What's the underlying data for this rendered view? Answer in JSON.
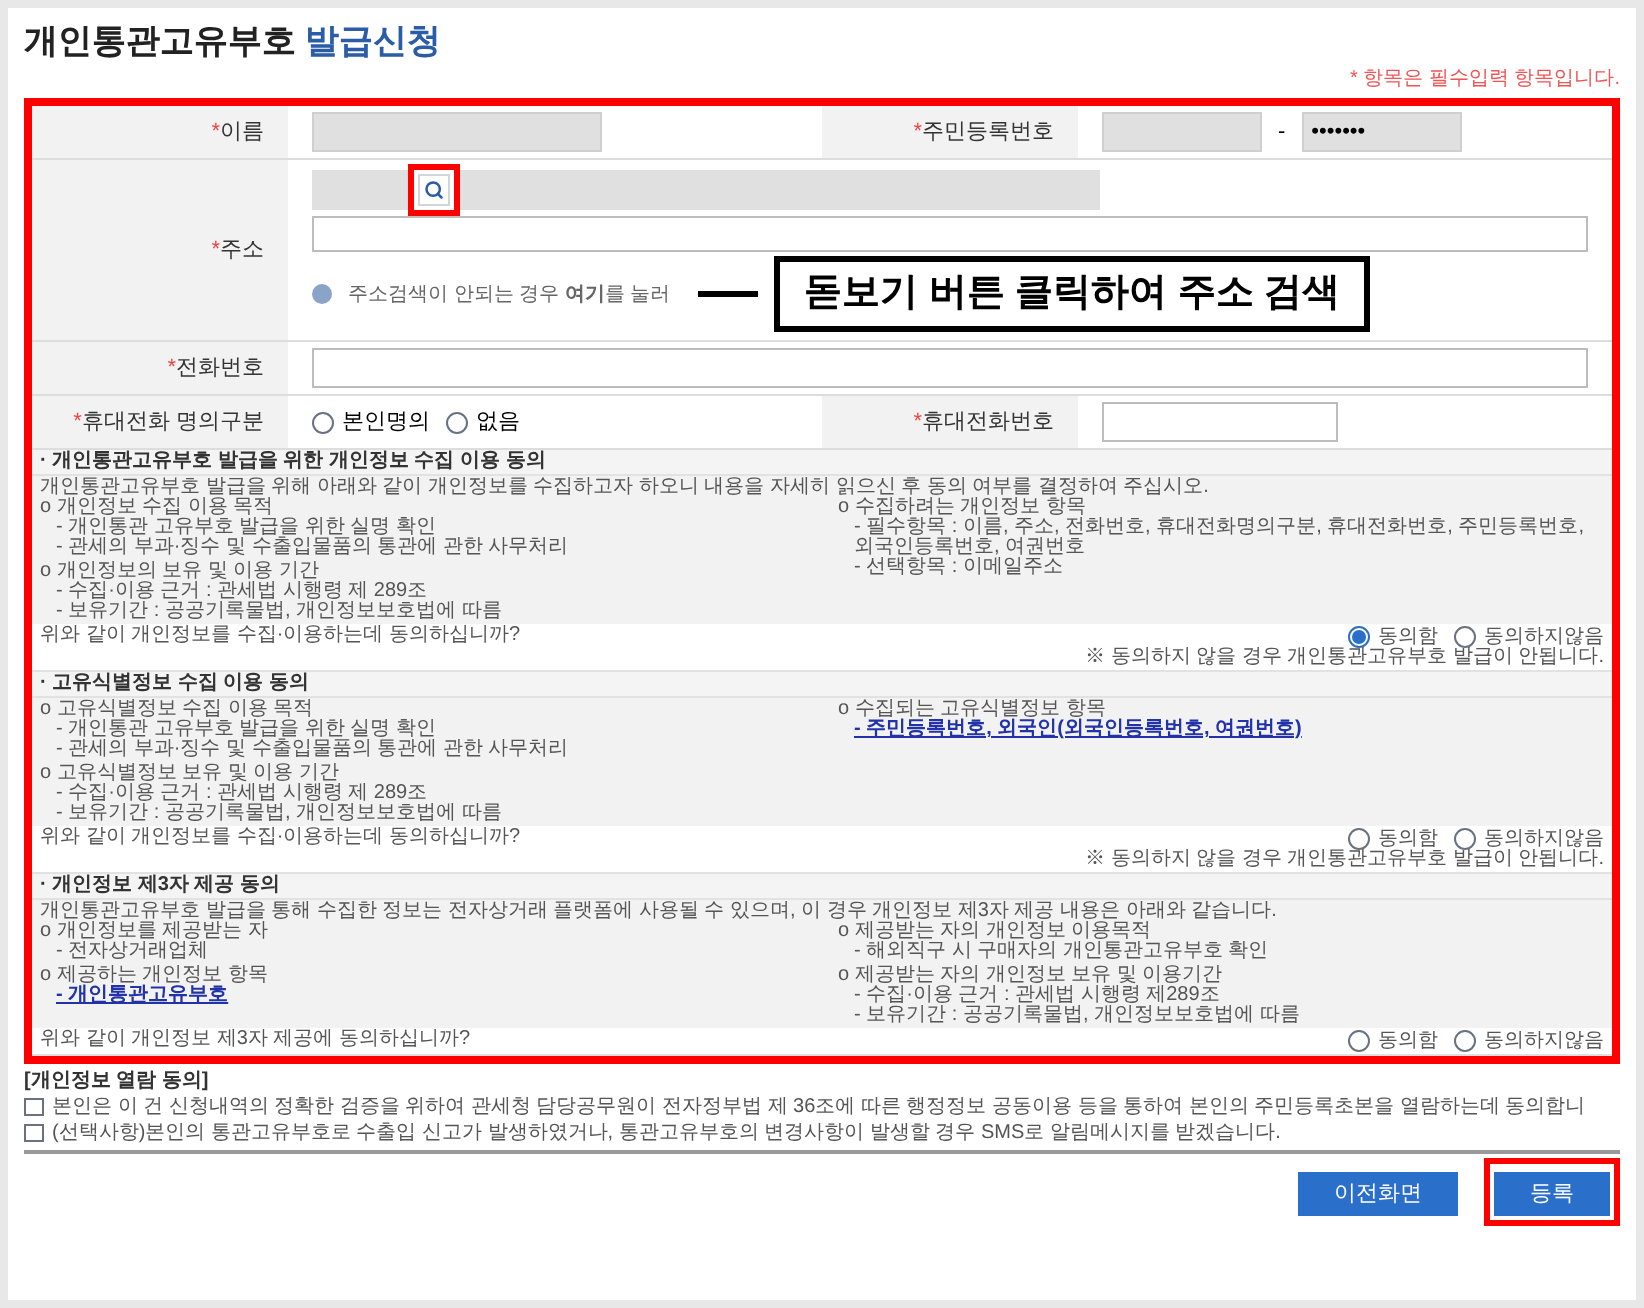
{
  "title": {
    "main": "개인통관고유부호",
    "accent": "발급신청"
  },
  "required_note": "* 항목은 필수입력 항목입니다.",
  "form_rows": [
    {
      "cells": [
        {
          "label": "이름",
          "required_mark": "*",
          "kind": "text",
          "disabled": true
        },
        {
          "label": "주민등록번호",
          "required_mark": "*",
          "kind": "rrn",
          "disabled": true,
          "separator": "-",
          "masked_value": "•••••••"
        }
      ]
    },
    {
      "cells": [
        {
          "label": "주소",
          "required_mark": "*",
          "kind": "address",
          "disabled": true,
          "hint": "주소검색이 안되는 경우 **여기**를 눌러"
        }
      ]
    },
    {
      "cells": [
        {
          "label": "전화번호",
          "required_mark": "*",
          "kind": "text",
          "disabled": false
        }
      ]
    },
    {
      "cells": [
        {
          "label": "휴대전화 명의구분",
          "required_mark": "*",
          "kind": "radio",
          "options": [
            {
              "label": "본인명의",
              "selected": false
            },
            {
              "label": "없음",
              "selected": false
            }
          ]
        },
        {
          "label": "휴대전화번호",
          "required_mark": "*",
          "kind": "short",
          "disabled": false
        }
      ]
    }
  ],
  "callout": "돋보기 버튼 클릭하여 주소 검색",
  "consents": [
    {
      "title": "· 개인통관고유부호 발급을 위한 개인정보 수집 이용 동의",
      "intro": "개인통관고유부호 발급을 위해 아래와 같이 개인정보를 수집하고자 하오니 내용을 자세히 읽으신 후 동의 여부를 결정하여 주십시오.",
      "groups": [
        {
          "heading": "o 개인정보 수집 이용 목적",
          "link_items": false,
          "items": [
            "- 개인통관 고유부호 발급을 위한 실명 확인",
            "- 관세의 부과·징수 및 수출입물품의 통관에 관한 사무처리"
          ]
        },
        {
          "heading": "o 수집하려는 개인정보 항목",
          "link_items": false,
          "items": [
            "- 필수항목 : 이름, 주소, 전화번호, 휴대전화명의구분, 휴대전화번호, 주민등록번호, 외국인등록번호, 여권번호",
            "- 선택항목 : 이메일주소"
          ]
        },
        {
          "heading": "o 개인정보의 보유 및 이용 기간",
          "link_items": false,
          "items": [
            "- 수집·이용 근거 : 관세법 시행령 제 289조",
            "- 보유기간 : 공공기록물법, 개인정보보호법에 따름"
          ]
        }
      ],
      "question": "위와 같이 개인정보를 수집·이용하는데 동의하십니까?",
      "options": [
        {
          "label": "동의함",
          "selected": true
        },
        {
          "label": "동의하지않음",
          "selected": false
        }
      ],
      "note": "※ 동의하지 않을 경우 개인통관고유부호 발급이 안됩니다."
    },
    {
      "title": "· 고유식별정보 수집 이용 동의",
      "groups": [
        {
          "heading": "o 고유식별정보 수집 이용 목적",
          "link_items": false,
          "items": [
            "- 개인통관 고유부호 발급을 위한 실명 확인",
            "- 관세의 부과·징수 및 수출입물품의 통관에 관한 사무처리"
          ]
        },
        {
          "heading": "o 수집되는 고유식별정보 항목",
          "link_items": true,
          "items": [
            "- 주민등록번호, 외국인(외국인등록번호, 여권번호)"
          ]
        },
        {
          "heading": "o 고유식별정보 보유 및 이용 기간",
          "link_items": false,
          "items": [
            "- 수집·이용 근거 : 관세법 시행령 제 289조",
            "- 보유기간 : 공공기록물법, 개인정보보호법에 따름"
          ]
        }
      ],
      "question": "위와 같이 개인정보를 수집·이용하는데 동의하십니까?",
      "options": [
        {
          "label": "동의함",
          "selected": false
        },
        {
          "label": "동의하지않음",
          "selected": false
        }
      ],
      "note": "※ 동의하지 않을 경우 개인통관고유부호 발급이 안됩니다."
    },
    {
      "title": "· 개인정보 제3자 제공 동의",
      "intro": "개인통관고유부호 발급을 통해 수집한 정보는 전자상거래 플랫폼에 사용될 수 있으며, 이 경우 개인정보 제3자 제공 내용은 아래와 같습니다.",
      "groups": [
        {
          "heading": "o 개인정보를 제공받는 자",
          "link_items": false,
          "items": [
            "- 전자상거래업체"
          ]
        },
        {
          "heading": "o 제공받는 자의 개인정보 이용목적",
          "link_items": false,
          "items": [
            "- 해외직구 시 구매자의 개인통관고유부호 확인"
          ]
        },
        {
          "heading": "o 제공하는 개인정보 항목",
          "link_items": true,
          "items": [
            "- 개인통관고유부호"
          ]
        },
        {
          "heading": "o 제공받는 자의 개인정보 보유 및 이용기간",
          "link_items": false,
          "items": [
            "- 수집·이용 근거 : 관세법 시행령 제289조",
            "- 보유기간 : 공공기록물법, 개인정보보호법에 따름"
          ]
        }
      ],
      "question": "위와 같이 개인정보 제3자 제공에 동의하십니까?",
      "options": [
        {
          "label": "동의함",
          "selected": false
        },
        {
          "label": "동의하지않음",
          "selected": false
        }
      ]
    }
  ],
  "viewing_consent": {
    "title": "[개인정보 열람 동의]",
    "items": [
      {
        "text": "본인은 이 건 신청내역의 정확한 검증을 위하여 관세청 담당공무원이 전자정부법 제 36조에 따른 행정정보 공동이용 등을 통하여 본인의 주민등록초본을 열람하는데 동의합니",
        "checked": false
      },
      {
        "text": "(선택사항)본인의 통관고유부호로 수출입 신고가 발생하였거나, 통관고유부호의 변경사항이 발생할 경우 SMS로 알림메시지를 받겠습니다.",
        "checked": false
      }
    ]
  },
  "buttons": [
    {
      "label": "이전화면",
      "highlighted": false
    },
    {
      "label": "등록",
      "highlighted": true
    }
  ]
}
